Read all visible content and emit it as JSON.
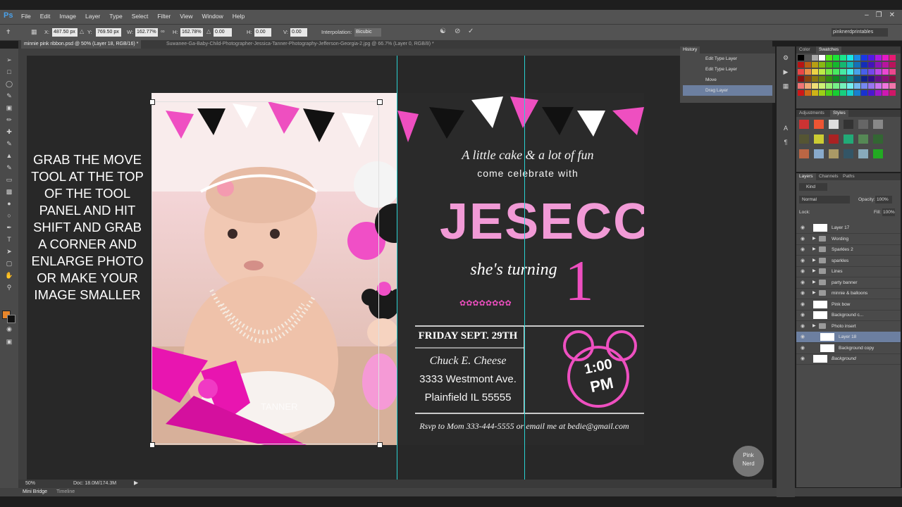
{
  "app": {
    "logo": "Ps"
  },
  "menu": [
    "File",
    "Edit",
    "Image",
    "Layer",
    "Type",
    "Select",
    "Filter",
    "View",
    "Window",
    "Help"
  ],
  "options": {
    "x_label": "X:",
    "x_value": "487.50 px",
    "y_label": "Y:",
    "y_value": "769.50 px",
    "w_label": "W:",
    "w_value": "162.77%",
    "h_label": "H:",
    "h_value": "162.78%",
    "angle_value": "0.00",
    "hskew_label": "H:",
    "hskew_value": "0.00",
    "vskew_label": "V:",
    "vskew_value": "0.00",
    "interp_label": "Interpolation:",
    "interp_value": "Bicubic",
    "workspace": "pinknerdprintables"
  },
  "tabs": [
    {
      "label": "minnie pink ribbon.psd @ 50% (Layer 18, RGB/16) *"
    },
    {
      "label": "Suwanee-Ga-Baby-Child-Photographer-Jessica-Tanner-Photography-Jefferson-Georgia-2.jpg @ 66.7% (Layer 0, RGB/8) *"
    }
  ],
  "instruction": "GRAB THE MOVE TOOL AT THE TOP OF THE TOOL PANEL AND HIT SHIFT AND GRAB A CORNER AND ENLARGE PHOTO OR MAKE YOUR IMAGE SMALLER",
  "invite": {
    "line1": "A little cake & a lot of fun",
    "line2": "come celebrate with",
    "name": "JESECCA",
    "turning": "she's turning",
    "age": "1",
    "date": "FRIDAY SEPT. 29TH",
    "venue": "Chuck E. Cheese",
    "street": "3333 Westmont Ave.",
    "city": "Plainfield IL 55555",
    "time1": "1:00",
    "time2": "PM",
    "rsvp": "Rsvp to Mom 333-444-5555 or email me at bedie@gmail.com"
  },
  "photo_watermark": "TANNER",
  "watermark_badge": {
    "line1": "Pink",
    "line2": "Nerd"
  },
  "status": {
    "zoom": "50%",
    "doc": "Doc: 18.0M/174.3M"
  },
  "bottom_tabs": [
    "Mini Bridge",
    "Timeline"
  ],
  "history": {
    "tab": "History",
    "items": [
      "Edit Type Layer",
      "Edit Type Layer",
      "Move",
      "Drag Layer"
    ]
  },
  "color_panel": {
    "tabs": [
      "Color",
      "Swatches"
    ]
  },
  "styles_panel": {
    "tabs": [
      "Adjustments",
      "Styles"
    ]
  },
  "layers_panel": {
    "tabs": [
      "Layers",
      "Channels",
      "Paths"
    ],
    "kind": "Kind",
    "blend_mode": "Normal",
    "opacity_label": "Opacity:",
    "opacity_value": "100%",
    "lock_label": "Lock:",
    "fill_label": "Fill:",
    "fill_value": "100%",
    "layers": [
      {
        "name": "Layer 17",
        "type": "layer"
      },
      {
        "name": "Wording",
        "type": "group"
      },
      {
        "name": "Sparkles 2",
        "type": "group"
      },
      {
        "name": "sparkles",
        "type": "group"
      },
      {
        "name": "Lines",
        "type": "group"
      },
      {
        "name": "party banner",
        "type": "group"
      },
      {
        "name": "minnie & balloons",
        "type": "group"
      },
      {
        "name": "Pink bow",
        "type": "layer"
      },
      {
        "name": "Background c...",
        "type": "layer"
      },
      {
        "name": "Photo insert",
        "type": "group"
      },
      {
        "name": "Layer 18",
        "type": "layer"
      },
      {
        "name": "Background copy",
        "type": "layer"
      },
      {
        "name": "Background",
        "type": "layer"
      }
    ]
  }
}
